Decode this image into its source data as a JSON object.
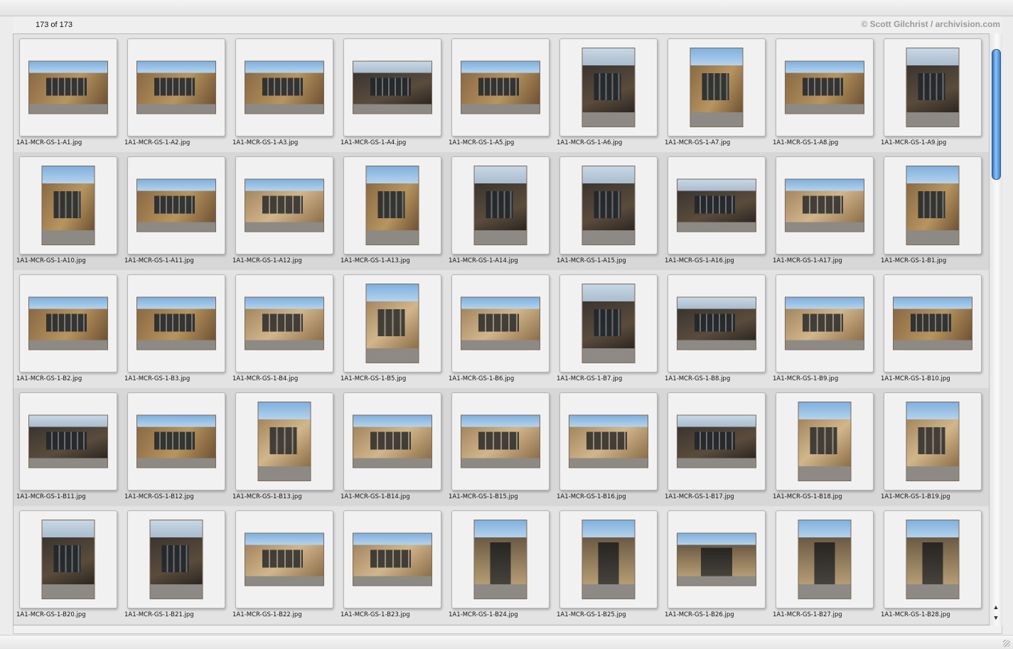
{
  "header": {
    "count": "173 of 173",
    "credit": "© Scott Gilchrist / archivision.com"
  },
  "thumbnails": [
    {
      "name": "1A1-MCR-GS-1-A1.jpg",
      "orientation": "land",
      "tone": "normal"
    },
    {
      "name": "1A1-MCR-GS-1-A2.jpg",
      "orientation": "land",
      "tone": "normal"
    },
    {
      "name": "1A1-MCR-GS-1-A3.jpg",
      "orientation": "land",
      "tone": "normal"
    },
    {
      "name": "1A1-MCR-GS-1-A4.jpg",
      "orientation": "land",
      "tone": "dark"
    },
    {
      "name": "1A1-MCR-GS-1-A5.jpg",
      "orientation": "land",
      "tone": "normal"
    },
    {
      "name": "1A1-MCR-GS-1-A6.jpg",
      "orientation": "port",
      "tone": "dark"
    },
    {
      "name": "1A1-MCR-GS-1-A7.jpg",
      "orientation": "port",
      "tone": "normal"
    },
    {
      "name": "1A1-MCR-GS-1-A8.jpg",
      "orientation": "land",
      "tone": "normal"
    },
    {
      "name": "1A1-MCR-GS-1-A9.jpg",
      "orientation": "port",
      "tone": "dark"
    },
    {
      "name": "1A1-MCR-GS-1-A10.jpg",
      "orientation": "port",
      "tone": "normal"
    },
    {
      "name": "1A1-MCR-GS-1-A11.jpg",
      "orientation": "land",
      "tone": "normal"
    },
    {
      "name": "1A1-MCR-GS-1-A12.jpg",
      "orientation": "land",
      "tone": "stone"
    },
    {
      "name": "1A1-MCR-GS-1-A13.jpg",
      "orientation": "port",
      "tone": "normal"
    },
    {
      "name": "1A1-MCR-GS-1-A14.jpg",
      "orientation": "port",
      "tone": "dark"
    },
    {
      "name": "1A1-MCR-GS-1-A15.jpg",
      "orientation": "port",
      "tone": "dark"
    },
    {
      "name": "1A1-MCR-GS-1-A16.jpg",
      "orientation": "land",
      "tone": "dark"
    },
    {
      "name": "1A1-MCR-GS-1-A17.jpg",
      "orientation": "land",
      "tone": "stone"
    },
    {
      "name": "1A1-MCR-GS-1-B1.jpg",
      "orientation": "port",
      "tone": "normal"
    },
    {
      "name": "1A1-MCR-GS-1-B2.jpg",
      "orientation": "land",
      "tone": "normal"
    },
    {
      "name": "1A1-MCR-GS-1-B3.jpg",
      "orientation": "land",
      "tone": "normal"
    },
    {
      "name": "1A1-MCR-GS-1-B4.jpg",
      "orientation": "land",
      "tone": "stone"
    },
    {
      "name": "1A1-MCR-GS-1-B5.jpg",
      "orientation": "port",
      "tone": "stone"
    },
    {
      "name": "1A1-MCR-GS-1-B6.jpg",
      "orientation": "land",
      "tone": "stone"
    },
    {
      "name": "1A1-MCR-GS-1-B7.jpg",
      "orientation": "port",
      "tone": "dark"
    },
    {
      "name": "1A1-MCR-GS-1-B8.jpg",
      "orientation": "land",
      "tone": "dark"
    },
    {
      "name": "1A1-MCR-GS-1-B9.jpg",
      "orientation": "land",
      "tone": "stone"
    },
    {
      "name": "1A1-MCR-GS-1-B10.jpg",
      "orientation": "land",
      "tone": "normal"
    },
    {
      "name": "1A1-MCR-GS-1-B11.jpg",
      "orientation": "land",
      "tone": "dark"
    },
    {
      "name": "1A1-MCR-GS-1-B12.jpg",
      "orientation": "land",
      "tone": "normal"
    },
    {
      "name": "1A1-MCR-GS-1-B13.jpg",
      "orientation": "port",
      "tone": "stone"
    },
    {
      "name": "1A1-MCR-GS-1-B14.jpg",
      "orientation": "land",
      "tone": "stone"
    },
    {
      "name": "1A1-MCR-GS-1-B15.jpg",
      "orientation": "land",
      "tone": "stone"
    },
    {
      "name": "1A1-MCR-GS-1-B16.jpg",
      "orientation": "land",
      "tone": "stone"
    },
    {
      "name": "1A1-MCR-GS-1-B17.jpg",
      "orientation": "land",
      "tone": "dark"
    },
    {
      "name": "1A1-MCR-GS-1-B18.jpg",
      "orientation": "port",
      "tone": "stone"
    },
    {
      "name": "1A1-MCR-GS-1-B19.jpg",
      "orientation": "port",
      "tone": "stone"
    },
    {
      "name": "1A1-MCR-GS-1-B20.jpg",
      "orientation": "port",
      "tone": "dark"
    },
    {
      "name": "1A1-MCR-GS-1-B21.jpg",
      "orientation": "port",
      "tone": "dark"
    },
    {
      "name": "1A1-MCR-GS-1-B22.jpg",
      "orientation": "land",
      "tone": "stone"
    },
    {
      "name": "1A1-MCR-GS-1-B23.jpg",
      "orientation": "land",
      "tone": "stone"
    },
    {
      "name": "1A1-MCR-GS-1-B24.jpg",
      "orientation": "port",
      "tone": "door"
    },
    {
      "name": "1A1-MCR-GS-1-B25.jpg",
      "orientation": "port",
      "tone": "door"
    },
    {
      "name": "1A1-MCR-GS-1-B26.jpg",
      "orientation": "land",
      "tone": "door"
    },
    {
      "name": "1A1-MCR-GS-1-B27.jpg",
      "orientation": "port",
      "tone": "door"
    },
    {
      "name": "1A1-MCR-GS-1-B28.jpg",
      "orientation": "port",
      "tone": "door"
    }
  ],
  "scrollbar": {
    "up_icon": "arrow-up-icon",
    "down_icon": "arrow-down-icon"
  }
}
